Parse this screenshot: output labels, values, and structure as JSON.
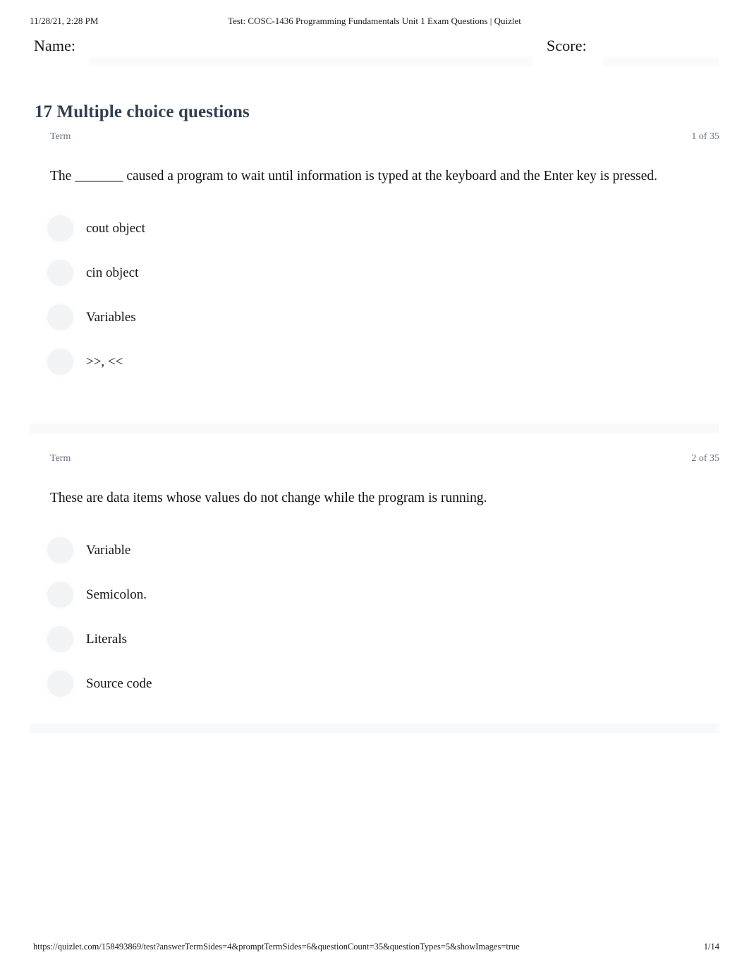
{
  "print_header": {
    "date": "11/28/21, 2:28 PM",
    "title": "Test: COSC-1436 Programming Fundamentals Unit 1 Exam Questions | Quizlet"
  },
  "meta": {
    "name_label": "Name:",
    "score_label": "Score:"
  },
  "section": {
    "heading": "17 Multiple choice questions"
  },
  "questions": [
    {
      "side_label": "Term",
      "index_label": "1 of 35",
      "prompt": "The _______ caused a program to wait until information is typed at the keyboard and the Enter key is pressed.",
      "options": [
        {
          "label": "cout object"
        },
        {
          "label": "cin object"
        },
        {
          "label": "Variables"
        },
        {
          "label": ">>, <<"
        }
      ]
    },
    {
      "side_label": "Term",
      "index_label": "2 of 35",
      "prompt": "These are data items whose values do not change while the program is running.",
      "options": [
        {
          "label": "Variable"
        },
        {
          "label": "Semicolon."
        },
        {
          "label": "Literals"
        },
        {
          "label": "Source code"
        }
      ]
    }
  ],
  "print_footer": {
    "url": "https://quizlet.com/158493869/test?answerTermSides=4&promptTermSides=6&questionCount=35&questionTypes=5&showImages=true",
    "page": "1/14"
  },
  "colors": {
    "heading": "#323e51",
    "meta_text": "#6a7080",
    "body_text": "#111111",
    "radio_fill": "#f2f3f5",
    "divider": "#f8f9fa",
    "page_background": "#ffffff"
  }
}
